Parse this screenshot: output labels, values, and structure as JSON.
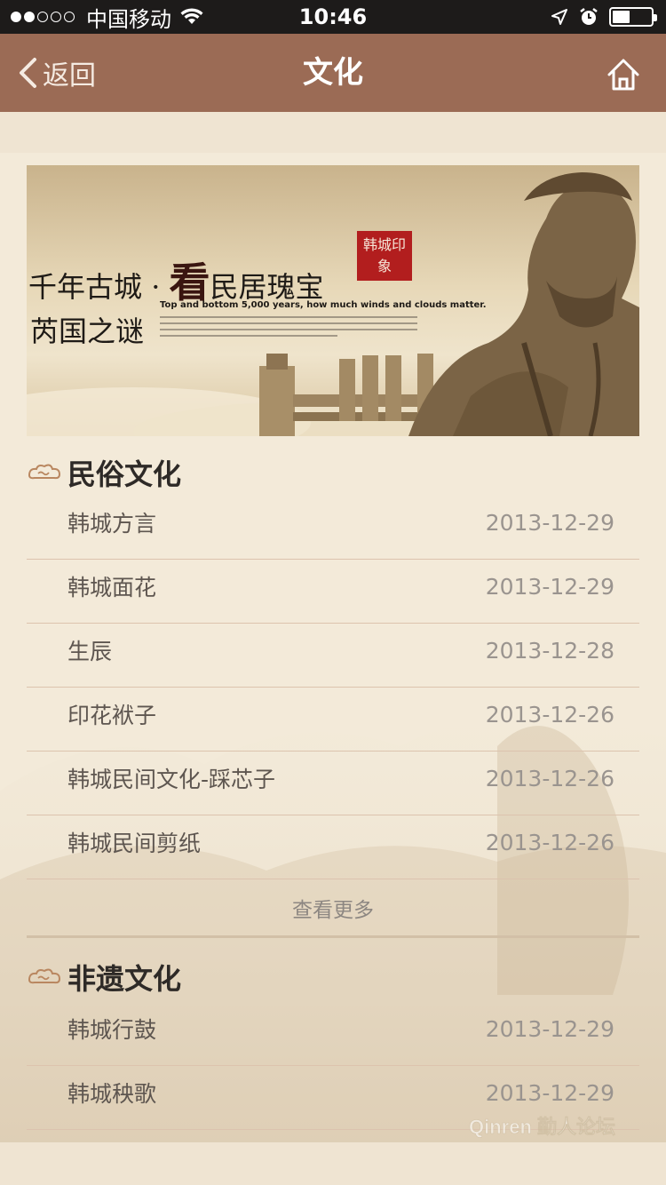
{
  "status_bar": {
    "carrier": "中国移动",
    "time": "10:46",
    "signal_strength": 2,
    "battery_level": 0.45
  },
  "nav": {
    "back_label": "返回",
    "title": "文化"
  },
  "banner": {
    "line1_a": "千年古城",
    "line1_b": "看",
    "line1_c": "民居瑰宝",
    "line2": "芮国之谜",
    "english": "Top and bottom 5,000 years, how much winds and clouds matter.",
    "seal_text": "韩城印象"
  },
  "sections": [
    {
      "title": "民俗文化",
      "items": [
        {
          "title": "韩城方言",
          "date": "2013-12-29"
        },
        {
          "title": "韩城面花",
          "date": "2013-12-29"
        },
        {
          "title": "生辰",
          "date": "2013-12-28"
        },
        {
          "title": "印花袱子",
          "date": "2013-12-26"
        },
        {
          "title": "韩城民间文化-踩芯子",
          "date": "2013-12-26"
        },
        {
          "title": "韩城民间剪纸",
          "date": "2013-12-26"
        }
      ],
      "more_label": "查看更多"
    },
    {
      "title": "非遗文化",
      "items": [
        {
          "title": "韩城行鼓",
          "date": "2013-12-29"
        },
        {
          "title": "韩城秧歌",
          "date": "2013-12-29"
        }
      ]
    }
  ],
  "watermark": "Qinren 勤人论坛",
  "colors": {
    "nav_bg": "#9b6b55",
    "page_bg": "#f3ead9",
    "divider": "#dcc3ae",
    "date_text": "#9a948f",
    "seal_red": "#b21e1e"
  }
}
